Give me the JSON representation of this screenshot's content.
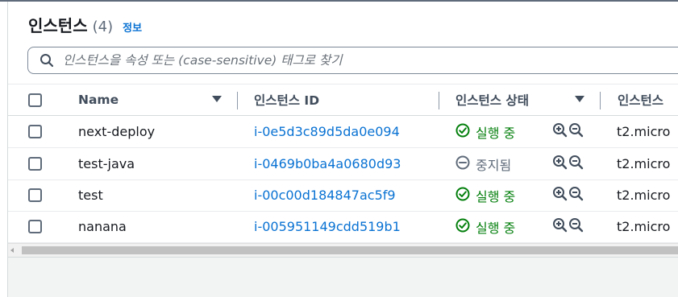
{
  "header": {
    "title": "인스턴스",
    "count": "(4)",
    "info_link": "정보"
  },
  "search": {
    "placeholder": "인스턴스을 속성 또는 (case-sensitive) 태그로 찾기"
  },
  "table": {
    "columns": {
      "name": "Name",
      "instance_id": "인스턴스 ID",
      "instance_state": "인스턴스 상태",
      "instance_type": "인스턴스"
    },
    "rows": [
      {
        "name": "next-deploy",
        "instance_id": "i-0e5d3c89d5da0e094",
        "state": "실행 중",
        "state_kind": "running",
        "type": "t2.micro"
      },
      {
        "name": "test-java",
        "instance_id": "i-0469b0ba4a0680d93",
        "state": "중지됨",
        "state_kind": "stopped",
        "type": "t2.micro"
      },
      {
        "name": "test",
        "instance_id": "i-00c00d184847ac5f9",
        "state": "실행 중",
        "state_kind": "running",
        "type": "t2.micro"
      },
      {
        "name": "nanana",
        "instance_id": "i-005951149cdd519b1",
        "state": "실행 중",
        "state_kind": "running",
        "type": "t2.micro"
      }
    ]
  },
  "icons": {
    "search": "search-icon",
    "running": "check-circle-icon",
    "stopped": "minus-circle-icon",
    "zoom_in": "zoom-in-icon",
    "zoom_out": "zoom-out-icon",
    "sort": "caret-down-icon"
  },
  "colors": {
    "link": "#0972d3",
    "running": "#037f0c",
    "stopped": "#5f6b7a",
    "text": "#16191f",
    "header_text": "#414d5c"
  }
}
